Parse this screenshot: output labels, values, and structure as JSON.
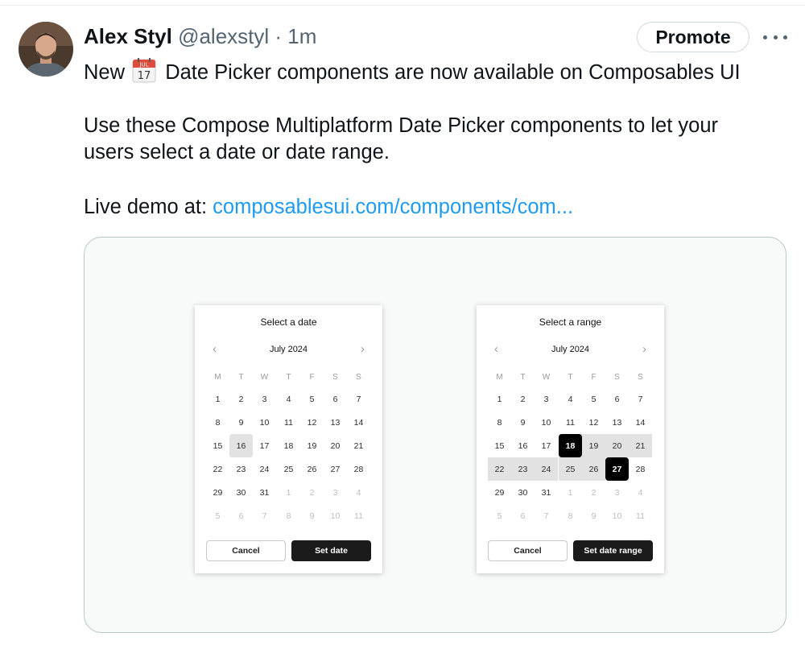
{
  "tweet": {
    "author_name": "Alex Styl",
    "handle": "@alexstyl",
    "separator": "·",
    "time": "1m",
    "promote_label": "Promote",
    "line1_before": "New",
    "emoji_month": "JUL",
    "emoji_day": "17",
    "line1_after": "Date Picker components are now available on Composables UI",
    "line2": "Use these Compose Multiplatform Date Picker components to let your",
    "line3": "users select a date or date range.",
    "line4_prefix": "Live demo at: ",
    "link_text": "composablesui.com/components/com..."
  },
  "colors": {
    "link": "#1d9bf0",
    "muted": "#536471",
    "media_border": "#b5c9c6"
  },
  "single_picker": {
    "title": "Select a date",
    "month": "July 2024",
    "prev_icon": "chevron-left-icon",
    "next_icon": "chevron-right-icon",
    "weekdays": [
      "M",
      "T",
      "W",
      "T",
      "F",
      "S",
      "S"
    ],
    "weeks": [
      [
        "1",
        "2",
        "3",
        "4",
        "5",
        "6",
        "7"
      ],
      [
        "8",
        "9",
        "10",
        "11",
        "12",
        "13",
        "14"
      ],
      [
        "15",
        "16",
        "17",
        "18",
        "19",
        "20",
        "21"
      ],
      [
        "22",
        "23",
        "24",
        "25",
        "26",
        "27",
        "28"
      ],
      [
        "29",
        "30",
        "31",
        "1",
        "2",
        "3",
        "4"
      ],
      [
        "5",
        "6",
        "7",
        "8",
        "9",
        "10",
        "11"
      ]
    ],
    "selected_day": "16",
    "cancel_label": "Cancel",
    "confirm_label": "Set date"
  },
  "range_picker": {
    "title": "Select a range",
    "month": "July 2024",
    "prev_icon": "chevron-left-icon",
    "next_icon": "chevron-right-icon",
    "weekdays": [
      "M",
      "T",
      "W",
      "T",
      "F",
      "S",
      "S"
    ],
    "weeks": [
      [
        "1",
        "2",
        "3",
        "4",
        "5",
        "6",
        "7"
      ],
      [
        "8",
        "9",
        "10",
        "11",
        "12",
        "13",
        "14"
      ],
      [
        "15",
        "16",
        "17",
        "18",
        "19",
        "20",
        "21"
      ],
      [
        "22",
        "23",
        "24",
        "25",
        "26",
        "27",
        "28"
      ],
      [
        "29",
        "30",
        "31",
        "1",
        "2",
        "3",
        "4"
      ],
      [
        "5",
        "6",
        "7",
        "8",
        "9",
        "10",
        "11"
      ]
    ],
    "range_start": "18",
    "range_end": "27",
    "cancel_label": "Cancel",
    "confirm_label": "Set date range"
  }
}
